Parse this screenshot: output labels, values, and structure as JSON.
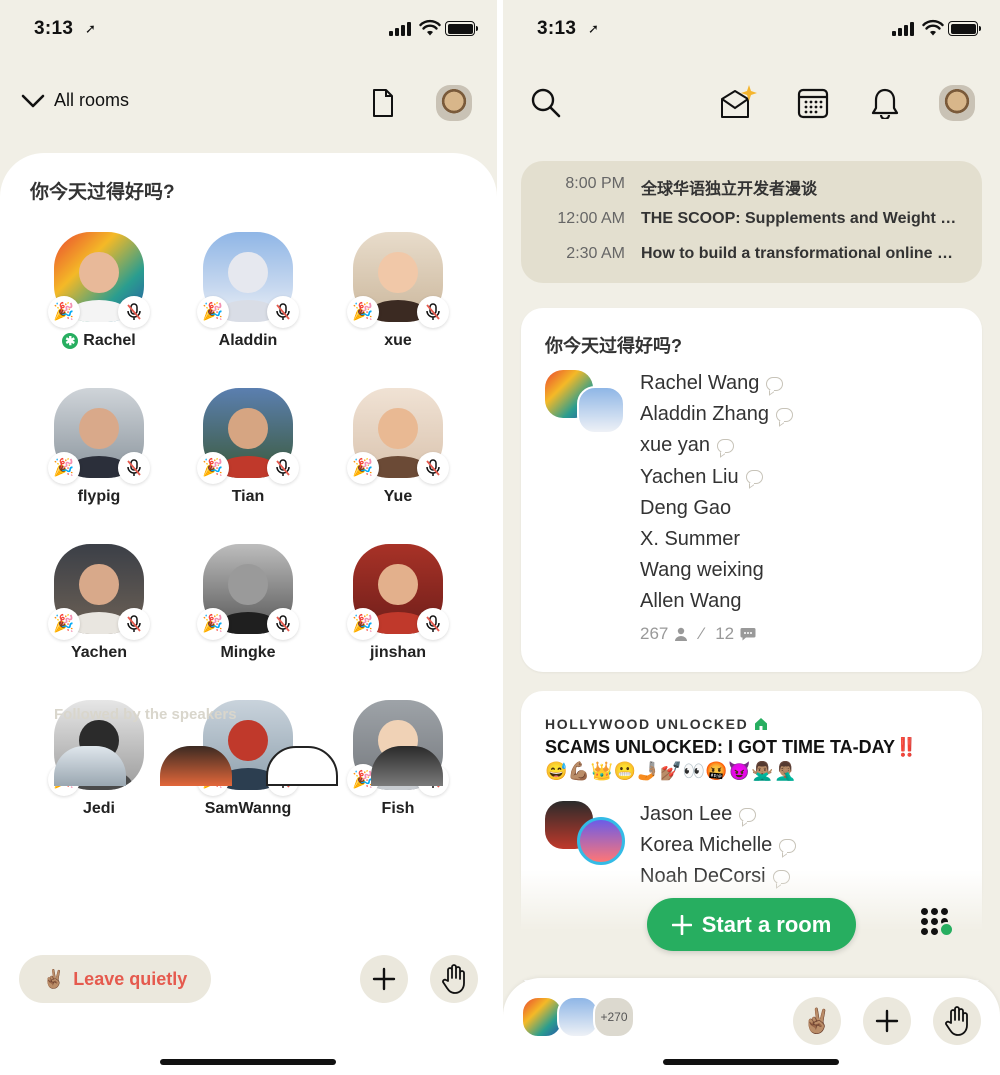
{
  "left_screen": {
    "status": {
      "time": "3:13"
    },
    "top_bar": {
      "rooms_label": "All rooms"
    },
    "room": {
      "title": "你今天过得好吗?",
      "speakers": [
        {
          "name": "Rachel",
          "moderator": true
        },
        {
          "name": "Aladdin"
        },
        {
          "name": "xue"
        },
        {
          "name": "flypig"
        },
        {
          "name": "Tian"
        },
        {
          "name": "Yue"
        },
        {
          "name": "Yachen"
        },
        {
          "name": "Mingke"
        },
        {
          "name": "jinshan"
        },
        {
          "name": "Jedi"
        },
        {
          "name": "SamWanng"
        },
        {
          "name": "Fish"
        }
      ],
      "followed_label": "Followed by the speakers"
    },
    "bottom_bar": {
      "leave_label": "Leave quietly",
      "leave_emoji": "✌🏽"
    }
  },
  "right_screen": {
    "status": {
      "time": "3:13"
    },
    "upcoming": [
      {
        "time": "8:00 PM",
        "title": "全球华语独立开发者漫谈"
      },
      {
        "time": "12:00 AM",
        "title": "THE SCOOP: Supplements and Weight Loss"
      },
      {
        "time": "2:30 AM",
        "title": "How to build a transformational online business"
      }
    ],
    "room_card_1": {
      "title": "你今天过得好吗?",
      "people": [
        {
          "name": "Rachel Wang",
          "speaker": true
        },
        {
          "name": "Aladdin Zhang",
          "speaker": true
        },
        {
          "name": "xue yan",
          "speaker": true
        },
        {
          "name": "Yachen Liu",
          "speaker": true
        },
        {
          "name": "Deng Gao",
          "speaker": false
        },
        {
          "name": "X. Summer",
          "speaker": false
        },
        {
          "name": "Wang weixing",
          "speaker": false
        },
        {
          "name": "Allen Wang",
          "speaker": false
        }
      ],
      "listeners": "267",
      "speakers": "12",
      "separator": "⁄"
    },
    "room_card_2": {
      "club": "HOLLYWOOD UNLOCKED",
      "title": "SCAMS UNLOCKED: I GOT TIME TA-DAY‼️",
      "emoji": "😅💪🏽👑😬🤳🏽💅🏽👀🤬😈🙅🏽‍♂️🤦🏽‍♂️",
      "people": [
        {
          "name": "Jason Lee",
          "speaker": true
        },
        {
          "name": "Korea Michelle",
          "speaker": true
        },
        {
          "name": "Noah DeCorsi",
          "speaker": true
        }
      ]
    },
    "start_room_label": "Start a room",
    "mini_bar": {
      "more_count": "+270",
      "wave_emoji": "✌🏽"
    }
  },
  "colors": {
    "background": "#f1efe6",
    "card": "#ffffff",
    "accent_green": "#27ae60",
    "leave_red": "#e55a4e",
    "upcoming_bg": "#e3dfcf"
  }
}
